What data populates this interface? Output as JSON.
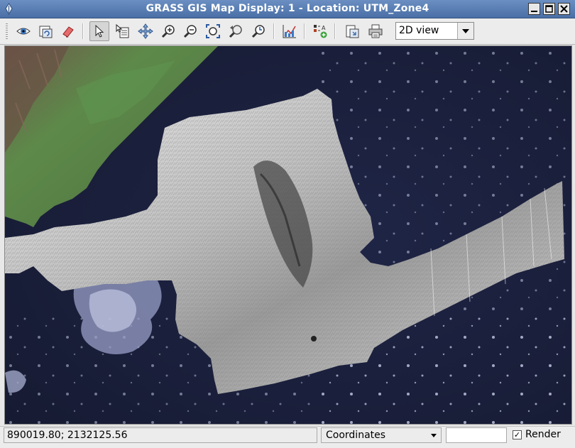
{
  "window": {
    "title": "GRASS GIS Map Display: 1  - Location: UTM_Zone4"
  },
  "toolbar": {
    "view_mode": "2D view",
    "view_mode_options": [
      "2D view"
    ],
    "tools": [
      {
        "name": "display-map-icon"
      },
      {
        "name": "render-map-icon"
      },
      {
        "name": "erase-icon"
      },
      {
        "name": "pointer-icon"
      },
      {
        "name": "query-icon"
      },
      {
        "name": "pan-icon"
      },
      {
        "name": "zoom-in-icon"
      },
      {
        "name": "zoom-out-icon"
      },
      {
        "name": "zoom-extent-icon"
      },
      {
        "name": "zoom-back-icon"
      },
      {
        "name": "zoom-menu-icon"
      },
      {
        "name": "analyze-icon"
      },
      {
        "name": "overlay-icon"
      },
      {
        "name": "save-file-icon"
      },
      {
        "name": "print-icon"
      }
    ]
  },
  "statusbar": {
    "coordinates_value": "890019.80; 2132125.56",
    "display_mode": "Coordinates",
    "render_label": "Render",
    "render_checked": true
  },
  "colors": {
    "titlebar": "#5a7fb6",
    "ocean": "#1a1f3a",
    "land": "#5e8a4a"
  }
}
